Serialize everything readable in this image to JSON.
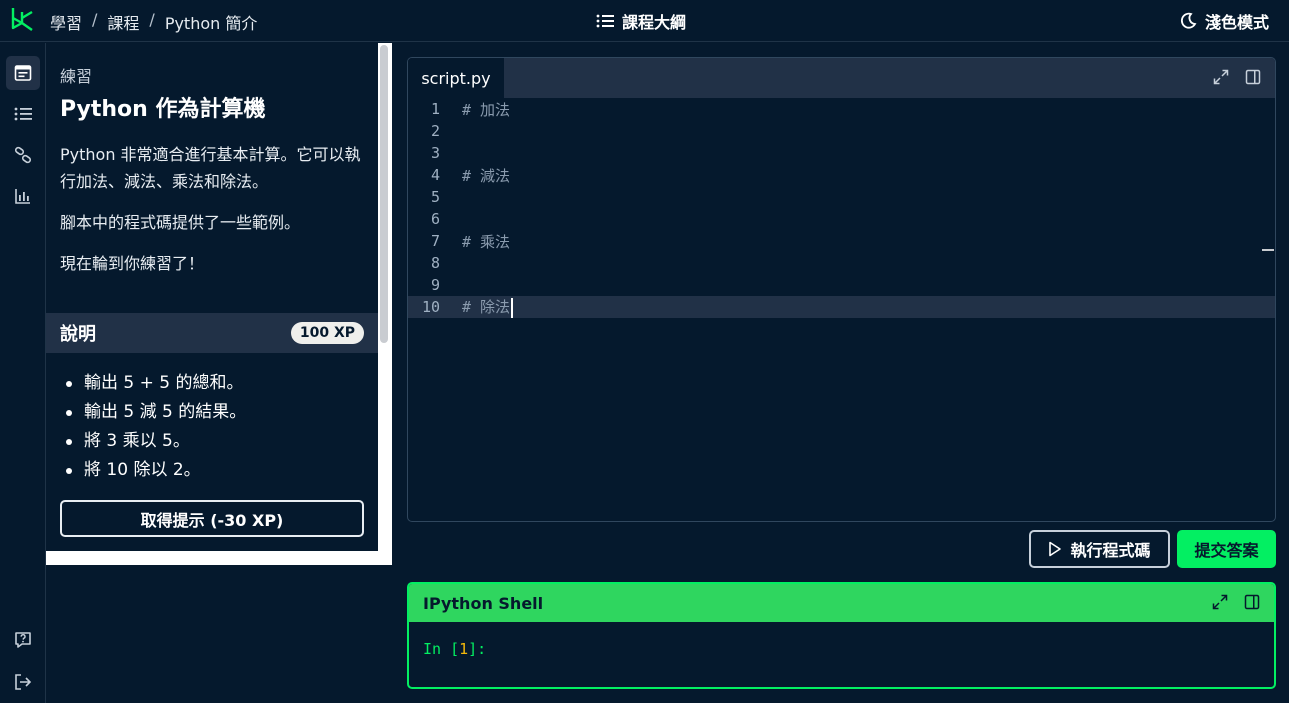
{
  "topbar": {
    "breadcrumbs": [
      "學習",
      "課程",
      "Python 簡介"
    ],
    "separator": "/",
    "outline_label": "課程大綱",
    "theme_label": "淺色模式"
  },
  "exercise": {
    "kicker": "練習",
    "title": "Python 作為計算機",
    "paragraphs": [
      "Python 非常適合進行基本計算。它可以執行加法、減法、乘法和除法。",
      "腳本中的程式碼提供了一些範例。",
      "現在輪到你練習了！"
    ]
  },
  "instructions": {
    "title": "說明",
    "xp": "100 XP",
    "items": [
      "輸出 5 + 5 的總和。",
      "輸出 5 減 5 的結果。",
      "將 3 乘以 5。",
      "將 10 除以 2。"
    ],
    "hint_label": "取得提示 (-30 XP)"
  },
  "editor": {
    "tab_label": "script.py",
    "lines": [
      {
        "n": "1",
        "text": "# 加法"
      },
      {
        "n": "2",
        "text": ""
      },
      {
        "n": "3",
        "text": ""
      },
      {
        "n": "4",
        "text": "# 減法"
      },
      {
        "n": "5",
        "text": ""
      },
      {
        "n": "6",
        "text": ""
      },
      {
        "n": "7",
        "text": "# 乘法"
      },
      {
        "n": "8",
        "text": ""
      },
      {
        "n": "9",
        "text": ""
      },
      {
        "n": "10",
        "text": "# 除法"
      }
    ],
    "current_line": 10
  },
  "actions": {
    "run_label": "執行程式碼",
    "submit_label": "提交答案"
  },
  "shell": {
    "title": "IPython Shell",
    "prompt_in": "In [",
    "prompt_num": "1",
    "prompt_end": "]:"
  },
  "colors": {
    "background": "#05192d",
    "panel": "#213147",
    "accent_green": "#03ef62"
  }
}
